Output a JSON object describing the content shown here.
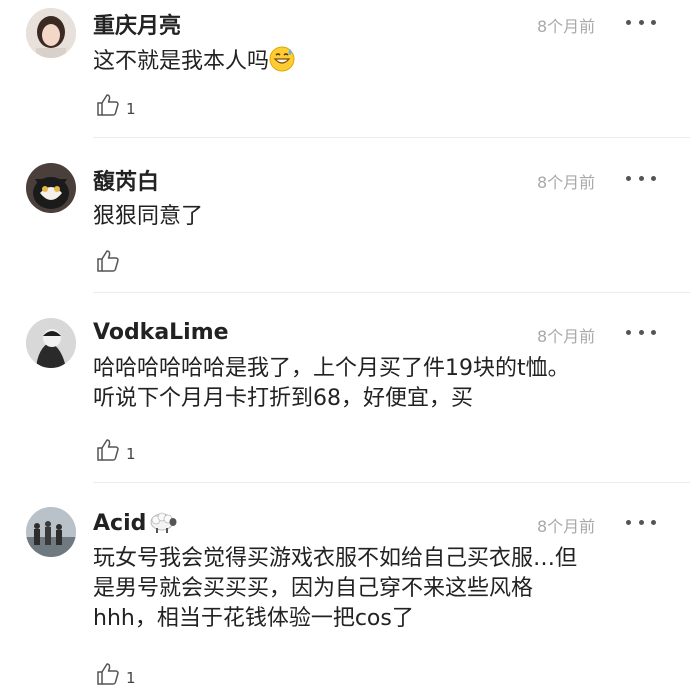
{
  "comments": [
    {
      "username": "重庆月亮",
      "time": "8个月前",
      "lines": [
        "这不就是我本人吗"
      ],
      "emoji": "grinning-sweat-emoji",
      "likes": "1"
    },
    {
      "username": "馥芮白",
      "time": "8个月前",
      "lines": [
        "狠狠同意了"
      ],
      "likes": ""
    },
    {
      "username": "VodkaLime",
      "time": "8个月前",
      "lines": [
        "哈哈哈哈哈哈是我了，上个月买了件19块的t恤。",
        "听说下个月月卡打折到68，好便宜，买"
      ],
      "likes": "1"
    },
    {
      "username": "Acid",
      "username_icon": "sheep-icon",
      "time": "8个月前",
      "lines": [
        "玩女号我会觉得买游戏衣服不如给自己买衣服…但",
        "是男号就会买买买，因为自己穿不来这些风格",
        "hhh，相当于花钱体验一把cos了"
      ],
      "likes": "1"
    }
  ],
  "icons": {
    "like": "thumbs-up-icon",
    "more": "more-dots-icon"
  },
  "colors": {
    "time": "#a9a9a9",
    "divider": "#ececec",
    "text": "#222222"
  }
}
